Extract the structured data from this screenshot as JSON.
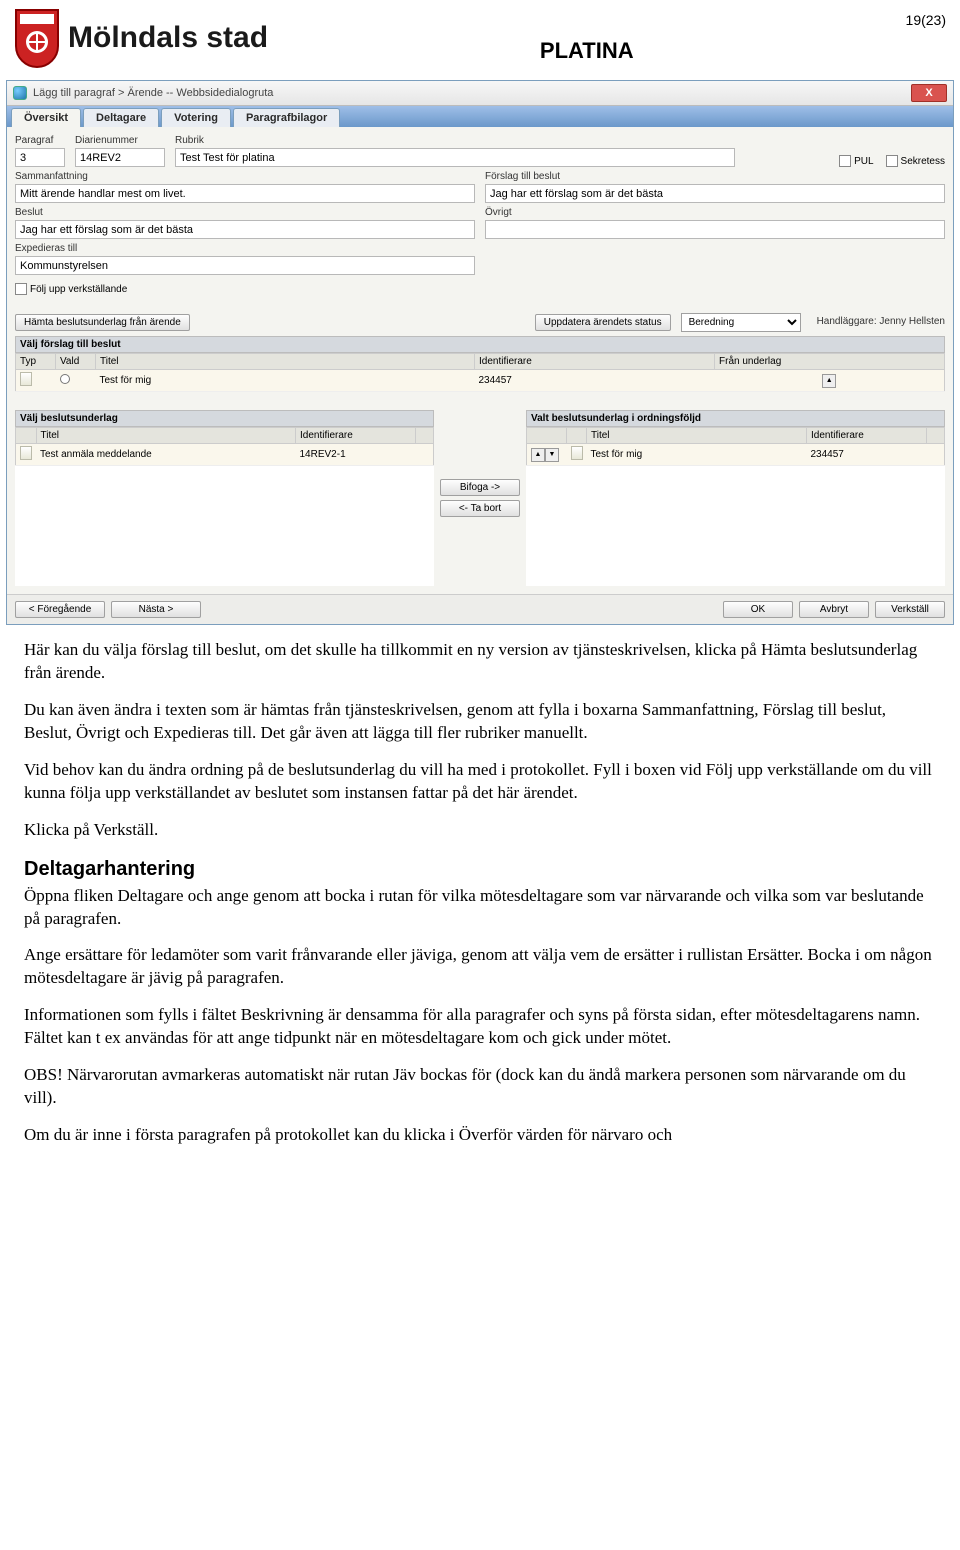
{
  "header": {
    "brand": "Mölndals stad",
    "title": "PLATINA",
    "page_num": "19(23)"
  },
  "dialog": {
    "title": "Lägg till paragraf > Ärende -- Webbsidedialogruta",
    "close": "X",
    "tabs": [
      "Översikt",
      "Deltagare",
      "Votering",
      "Paragrafbilagor"
    ],
    "top": {
      "paragraf_lbl": "Paragraf",
      "paragraf_val": "3",
      "diarie_lbl": "Diarienummer",
      "diarie_val": "14REV2",
      "rubrik_lbl": "Rubrik",
      "rubrik_val": "Test Test för platina",
      "pul_lbl": "PUL",
      "sekretess_lbl": "Sekretess",
      "samman_lbl": "Sammanfattning",
      "samman_val": "Mitt ärende handlar mest om livet.",
      "forslag_lbl": "Förslag till beslut",
      "forslag_val": "Jag har ett förslag som är det bästa",
      "beslut_lbl": "Beslut",
      "beslut_val": "Jag har ett förslag som är det bästa",
      "ovrigt_lbl": "Övrigt",
      "ovrigt_val": "",
      "exped_lbl": "Expedieras till",
      "exped_val": "Kommunstyrelsen",
      "folj_lbl": "Följ upp verkställande"
    },
    "mid": {
      "hamta_btn": "Hämta beslutsunderlag från ärende",
      "uppdatera_btn": "Uppdatera ärendets status",
      "status_val": "Beredning",
      "handlaggare": "Handläggare: Jenny Hellsten"
    },
    "valj_forslag": {
      "hdr": "Välj förslag till beslut",
      "cols": [
        "Typ",
        "Vald",
        "Titel",
        "Identifierare",
        "Från underlag"
      ],
      "row": {
        "titel": "Test för mig",
        "ident": "234457"
      }
    },
    "valj_underlag": {
      "hdr": "Välj beslutsunderlag",
      "cols": [
        "Titel",
        "Identifierare"
      ],
      "row": {
        "titel": "Test anmäla meddelande",
        "ident": "14REV2-1"
      }
    },
    "valt_underlag": {
      "hdr": "Valt beslutsunderlag i ordningsföljd",
      "cols": [
        "Titel",
        "Identifierare"
      ],
      "row": {
        "titel": "Test för mig",
        "ident": "234457"
      }
    },
    "transfer": {
      "bifoga": "Bifoga ->",
      "tabort": "<- Ta bort"
    },
    "footer": {
      "prev": "< Föregående",
      "next": "Nästa >",
      "ok": "OK",
      "avbryt": "Avbryt",
      "verkstall": "Verkställ"
    }
  },
  "doc": {
    "p1": "Här kan du välja förslag till beslut, om det skulle ha tillkommit en ny version av tjänsteskrivelsen, klicka på Hämta beslutsunderlag från ärende.",
    "p2": "Du kan även ändra i texten som är hämtas från tjänsteskrivelsen, genom att fylla i boxarna Sammanfattning, Förslag till beslut, Beslut, Övrigt och Expedieras till. Det går även att lägga till fler rubriker manuellt.",
    "p3": "Vid behov kan du ändra ordning på de beslutsunderlag du vill ha med i protokollet. Fyll i boxen vid Följ upp verkställande om du vill kunna följa upp verkställandet av beslutet som instansen fattar på det här ärendet.",
    "p4": "Klicka på Verkställ.",
    "h3": "Deltagarhantering",
    "p5": "Öppna fliken Deltagare och ange genom att bocka i rutan för vilka mötesdeltagare som var närvarande och vilka som var beslutande på paragrafen.",
    "p6": "Ange ersättare för ledamöter som varit frånvarande eller jäviga, genom att välja vem de ersätter i rullistan Ersätter. Bocka i om någon mötesdeltagare är jävig på paragrafen.",
    "p7": "Informationen som fylls i fältet Beskrivning är densamma för alla paragrafer och syns på första sidan, efter mötesdeltagarens namn. Fältet kan t ex användas för att ange tidpunkt när en mötesdeltagare kom och gick under mötet.",
    "p8": "OBS! Närvarorutan avmarkeras automatiskt när rutan Jäv bockas för (dock kan du ändå markera personen som närvarande om du vill).",
    "p9": "Om du är inne i första paragrafen på protokollet kan du klicka i Överför värden för närvaro och"
  }
}
